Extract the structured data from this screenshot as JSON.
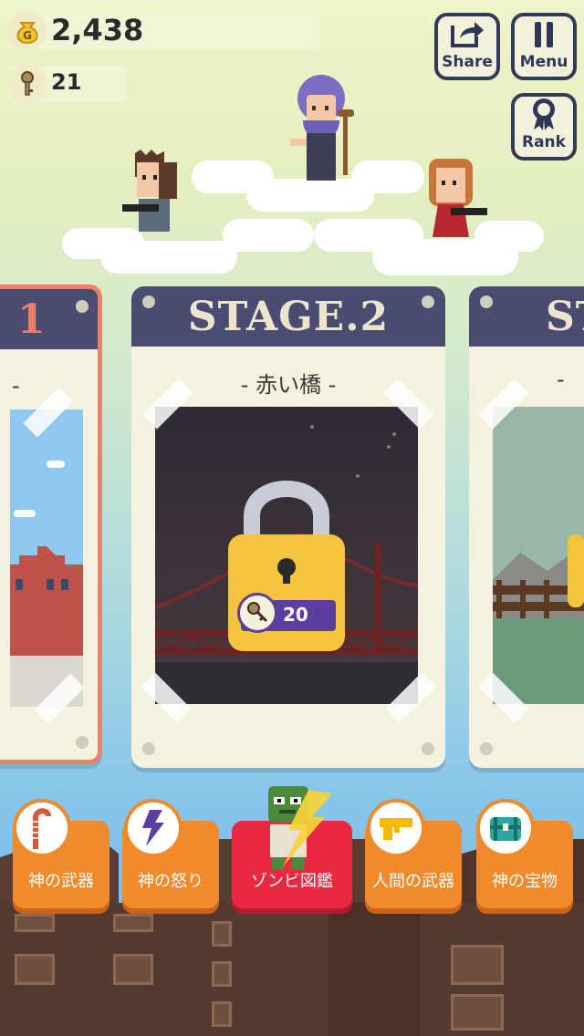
{
  "hud": {
    "gold": "2,438",
    "gold_icon": "G",
    "keys": "21"
  },
  "top_buttons": {
    "share": "Share",
    "menu": "Menu",
    "rank": "Rank"
  },
  "stages": {
    "prev": {
      "title": "1",
      "subtitle": "-"
    },
    "current": {
      "title": "STAGE.2",
      "subtitle": "- 赤い橋 -",
      "key_cost": "20"
    },
    "next": {
      "title": "ST",
      "subtitle": "-"
    }
  },
  "nav": {
    "items": [
      {
        "label": "神の武器",
        "icon": "cane-icon"
      },
      {
        "label": "神の怒り",
        "icon": "lightning-icon"
      },
      {
        "label": "ゾンビ図鑑",
        "icon": "zombie-icon"
      },
      {
        "label": "人間の武器",
        "icon": "gun-icon"
      },
      {
        "label": "神の宝物",
        "icon": "treasure-chest-icon"
      }
    ]
  },
  "colors": {
    "card_header": "#4b4c72",
    "card_body": "#f4f1de",
    "nav_orange": "#f08a2a",
    "nav_active": "#e8293f",
    "lock_yellow": "#f3c43c",
    "badge_purple": "#5b3ea0"
  }
}
